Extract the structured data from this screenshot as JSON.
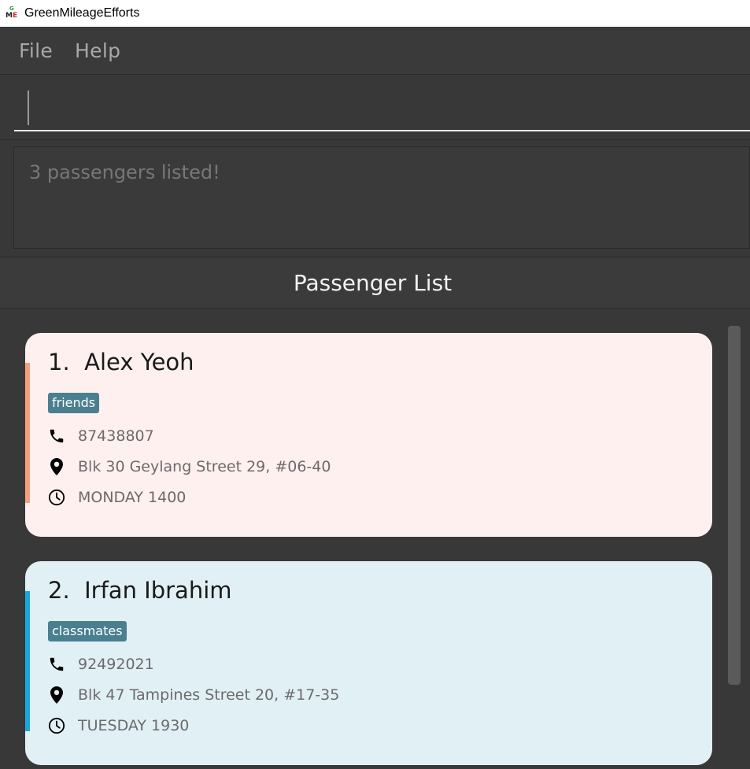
{
  "window": {
    "title": "GreenMileageEfforts"
  },
  "menu": {
    "file": "File",
    "help": "Help"
  },
  "command": {
    "value": ""
  },
  "result": {
    "message": "3 passengers listed!"
  },
  "list": {
    "header": "Passenger List",
    "passengers": [
      {
        "index": "1.",
        "name": "Alex Yeoh",
        "tag": "friends",
        "phone": "87438807",
        "address": "Blk 30 Geylang Street 29, #06-40",
        "time": "MONDAY 1400",
        "colors": {
          "card": "#fef0ee",
          "accent": "#f4a07e"
        }
      },
      {
        "index": "2.",
        "name": "Irfan Ibrahim",
        "tag": "classmates",
        "phone": "92492021",
        "address": "Blk 47 Tampines Street 20, #17-35",
        "time": "TUESDAY 1930",
        "colors": {
          "card": "#e1f0f5",
          "accent": "#1aa8dc"
        }
      }
    ]
  },
  "icons": {
    "phone": "phone-icon",
    "address": "location-pin-icon",
    "time": "clock-icon"
  }
}
